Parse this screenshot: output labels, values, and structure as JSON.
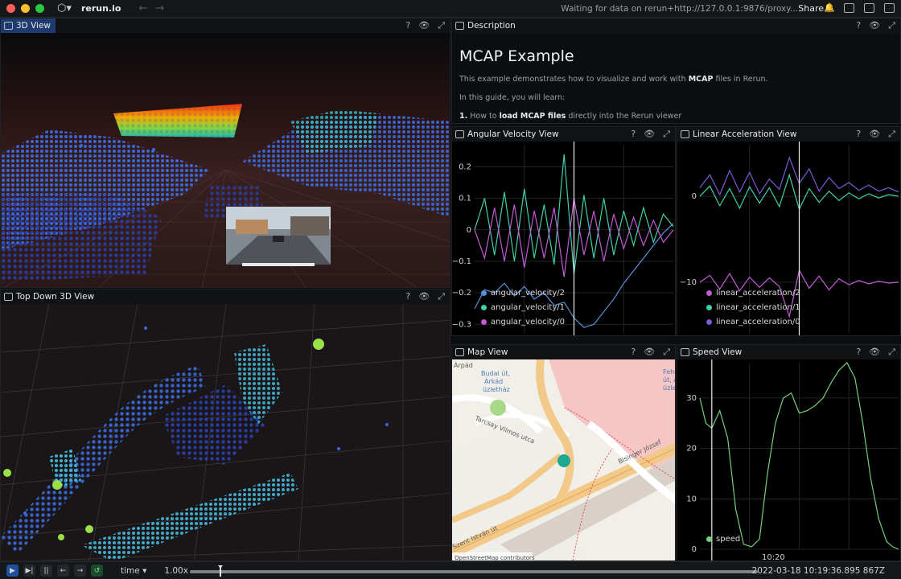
{
  "app": {
    "name": "rerun.io",
    "status": "Waiting for data on rerun+http://127.0.0.1:9876/proxy...",
    "share_label": "Share",
    "icons": [
      "rerun-logo-icon",
      "back-arrow-icon",
      "forward-arrow-icon",
      "notification-bell-icon",
      "left-panel-icon",
      "bottom-panel-icon",
      "right-panel-icon"
    ]
  },
  "panels": {
    "view3d": {
      "title": "3D View"
    },
    "topdown": {
      "title": "Top Down 3D View"
    },
    "description": {
      "title": "Description"
    },
    "angular": {
      "title": "Angular Velocity View"
    },
    "linear": {
      "title": "Linear Acceleration View"
    },
    "map": {
      "title": "Map View"
    },
    "speed": {
      "title": "Speed View"
    },
    "header_icons": {
      "help": "?",
      "visibility": "👁",
      "maximize": "⤢"
    }
  },
  "description": {
    "heading": "MCAP Example",
    "intro_pre": "This example demonstrates how to visualize and work with ",
    "intro_bold": "MCAP",
    "intro_post": " files in Rerun.",
    "guide": "In this guide, you will learn:",
    "item1_num": "1.",
    "item1_pre": "How to ",
    "item1_bold": "load MCAP files",
    "item1_post": " directly into the Rerun viewer"
  },
  "map": {
    "labels": {
      "arpad": "Árpád",
      "budai": "Budai út,",
      "arkad": "Árkád",
      "uzlethaz": "üzletház",
      "tarcsay": "Tarcsay Vilmos utca",
      "bisinger": "Bisinger József",
      "szent": "Szent István út",
      "fehe": "Fehé",
      "ut_a": "út, Á",
      "uzle": "üzle"
    },
    "attribution": "OpenStreetMap contributors"
  },
  "timeline": {
    "timeline_name": "time",
    "speed": "1.00x",
    "current_time": "2022-03-18 10:19:36.895 867Z",
    "progress": 0.053,
    "icons": [
      "play-icon",
      "step-end-icon",
      "pause-icon",
      "step-back-icon",
      "step-forward-icon",
      "loop-icon"
    ]
  },
  "colors": {
    "accent": "#1e3a6e",
    "angular_velocity_2": "#5b8fd6",
    "angular_velocity_1": "#3fd0a8",
    "angular_velocity_0": "#c35ad6",
    "linear_acceleration_2": "#c35ad6",
    "linear_acceleration_1": "#3fd0a8",
    "linear_acceleration_0": "#7b5ad6",
    "speed": "#74d07a",
    "map_marker": "#1fa891"
  },
  "chart_data": [
    {
      "type": "line",
      "title": "",
      "xlabel": "",
      "ylabel": "",
      "ylim": [
        -0.33,
        0.27
      ],
      "yticks": [
        0.2,
        0.1,
        0,
        -0.1,
        -0.2,
        -0.3
      ],
      "ytick_labels": [
        "0.2",
        "0.1",
        "0",
        "−0.1",
        "−0.2",
        "−0.3"
      ],
      "grid": true,
      "legend": "bottom-left",
      "series": [
        {
          "name": "angular_velocity/2",
          "x": [
            0,
            0.05,
            0.1,
            0.15,
            0.2,
            0.25,
            0.3,
            0.35,
            0.4,
            0.45,
            0.5,
            0.55,
            0.6,
            0.65,
            0.7,
            0.75,
            0.8,
            0.85,
            0.9,
            0.95,
            1
          ],
          "values": [
            -0.25,
            -0.19,
            -0.2,
            -0.17,
            -0.21,
            -0.18,
            -0.22,
            -0.2,
            -0.24,
            -0.23,
            -0.28,
            -0.31,
            -0.3,
            -0.26,
            -0.22,
            -0.17,
            -0.13,
            -0.09,
            -0.05,
            -0.01,
            0.02
          ]
        },
        {
          "name": "angular_velocity/1",
          "x": [
            0,
            0.05,
            0.1,
            0.15,
            0.2,
            0.25,
            0.3,
            0.35,
            0.4,
            0.45,
            0.5,
            0.55,
            0.6,
            0.65,
            0.7,
            0.75,
            0.8,
            0.85,
            0.9,
            0.95,
            1
          ],
          "values": [
            0.0,
            0.1,
            -0.08,
            0.12,
            -0.1,
            0.13,
            -0.09,
            0.08,
            -0.11,
            0.24,
            -0.14,
            0.11,
            -0.09,
            0.1,
            -0.08,
            0.06,
            -0.05,
            0.07,
            -0.04,
            0.05,
            0.01
          ]
        },
        {
          "name": "angular_velocity/0",
          "x": [
            0,
            0.05,
            0.1,
            0.15,
            0.2,
            0.25,
            0.3,
            0.35,
            0.4,
            0.45,
            0.5,
            0.55,
            0.6,
            0.65,
            0.7,
            0.75,
            0.8,
            0.85,
            0.9,
            0.95,
            1
          ],
          "values": [
            0.0,
            -0.09,
            0.07,
            -0.1,
            0.08,
            -0.12,
            0.06,
            -0.09,
            0.07,
            -0.15,
            0.1,
            -0.08,
            0.06,
            -0.1,
            0.05,
            -0.06,
            0.04,
            -0.05,
            0.03,
            -0.04,
            0.0
          ]
        }
      ]
    },
    {
      "type": "line",
      "title": "",
      "xlabel": "",
      "ylabel": "",
      "ylim": [
        -16,
        6
      ],
      "yticks": [
        0,
        -10
      ],
      "ytick_labels": [
        "0",
        "−10"
      ],
      "grid": true,
      "legend": "bottom-left",
      "series": [
        {
          "name": "linear_acceleration/2",
          "x": [
            0,
            0.05,
            0.1,
            0.15,
            0.2,
            0.25,
            0.3,
            0.35,
            0.4,
            0.45,
            0.5,
            0.55,
            0.6,
            0.65,
            0.7,
            0.75,
            0.8,
            0.85,
            0.9,
            0.95,
            1
          ],
          "values": [
            -10,
            -9.2,
            -10.8,
            -9.0,
            -11.0,
            -9.4,
            -10.6,
            -9.5,
            -10.5,
            -14.0,
            -8.6,
            -10.7,
            -9.3,
            -10.9,
            -9.6,
            -10.3,
            -9.8,
            -10.2,
            -9.9,
            -10.1,
            -10
          ]
        },
        {
          "name": "linear_acceleration/1",
          "x": [
            0,
            0.05,
            0.1,
            0.15,
            0.2,
            0.25,
            0.3,
            0.35,
            0.4,
            0.45,
            0.5,
            0.55,
            0.6,
            0.65,
            0.7,
            0.75,
            0.8,
            0.85,
            0.9,
            0.95,
            1
          ],
          "values": [
            0,
            1.2,
            -1.1,
            0.9,
            -1.4,
            1.1,
            -0.8,
            1.0,
            -1.2,
            2.5,
            -1.5,
            0.9,
            -0.7,
            0.6,
            -0.5,
            0.4,
            -0.3,
            0.3,
            -0.2,
            0.2,
            0
          ]
        },
        {
          "name": "linear_acceleration/0",
          "x": [
            0,
            0.05,
            0.1,
            0.15,
            0.2,
            0.25,
            0.3,
            0.35,
            0.4,
            0.45,
            0.5,
            0.55,
            0.6,
            0.65,
            0.7,
            0.75,
            0.8,
            0.85,
            0.9,
            0.95,
            1
          ],
          "values": [
            1.0,
            2.5,
            0.2,
            3.0,
            0.5,
            2.8,
            0.3,
            2.0,
            0.8,
            4.5,
            1.5,
            3.2,
            0.6,
            2.2,
            0.9,
            1.6,
            0.7,
            1.3,
            0.6,
            1.0,
            0.5
          ]
        }
      ]
    },
    {
      "type": "line",
      "title": "",
      "xlabel": "",
      "ylabel": "",
      "ylim": [
        0,
        37
      ],
      "yticks": [
        0,
        10,
        20,
        30
      ],
      "ytick_labels": [
        "0",
        "10",
        "20",
        "30"
      ],
      "xtick_labels": [
        "10:20"
      ],
      "grid": true,
      "legend": "bottom-left",
      "series": [
        {
          "name": "speed",
          "x": [
            0,
            0.03,
            0.06,
            0.1,
            0.14,
            0.18,
            0.22,
            0.26,
            0.3,
            0.34,
            0.38,
            0.42,
            0.46,
            0.5,
            0.54,
            0.58,
            0.62,
            0.66,
            0.7,
            0.74,
            0.78,
            0.82,
            0.86,
            0.9,
            0.94,
            0.97,
            1
          ],
          "values": [
            30,
            25,
            24,
            27.5,
            22,
            8,
            1,
            0.5,
            2,
            15,
            25,
            30,
            31,
            27,
            27.5,
            28.5,
            30,
            33,
            35.5,
            37,
            34,
            25,
            14,
            6,
            1.5,
            0.5,
            0
          ]
        }
      ]
    }
  ]
}
